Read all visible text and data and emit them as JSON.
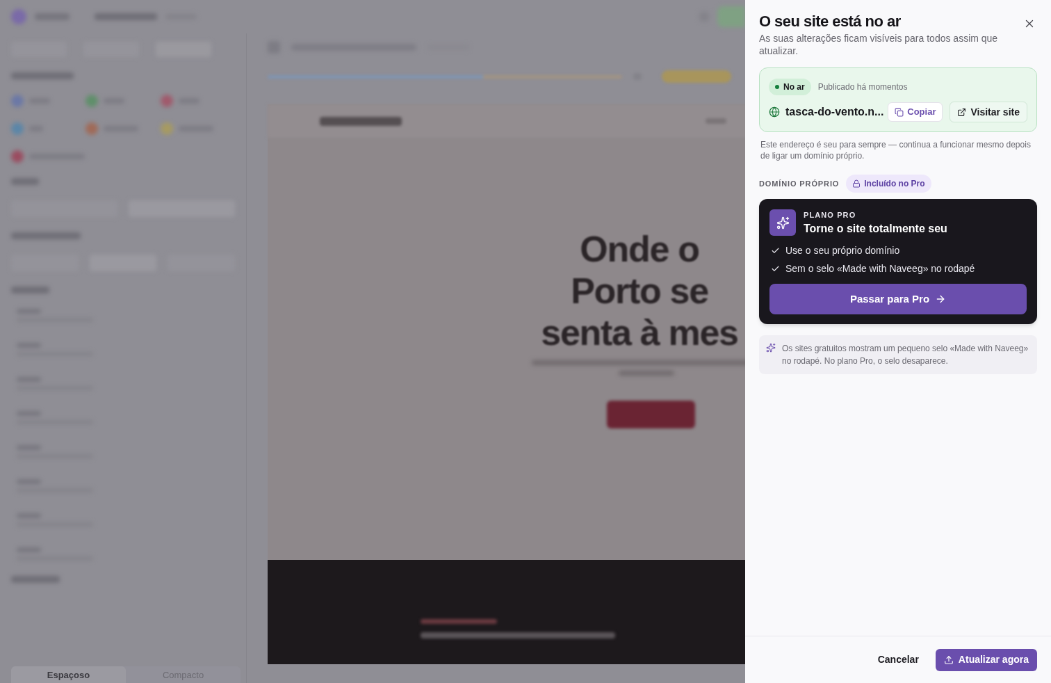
{
  "backdrop": {
    "hero_heading": "Onde o Porto se senta à mes",
    "density_options": [
      {
        "label": "Espaçoso",
        "selected": true
      },
      {
        "label": "Compacto",
        "selected": false
      }
    ]
  },
  "panel": {
    "title": "O seu site está no ar",
    "subtitle": "As suas alterações ficam visíveis para todos assim que atualizar.",
    "status_card": {
      "status": "No ar",
      "published": "Publicado há momentos",
      "url": "tasca-do-vento.n...",
      "copy_button": "Copiar",
      "visit_button": "Visitar site"
    },
    "address_note": "Este endereço é seu para sempre — continua a funcionar mesmo depois de ligar um domínio próprio.",
    "custom_domain": {
      "label": "DOMÍNIO PRÓPRIO",
      "badge": "Incluído no Pro"
    },
    "pro_card": {
      "eyebrow": "PLANO PRO",
      "title": "Torne o site totalmente seu",
      "features": [
        "Use o seu próprio domínio",
        "Sem o selo «Made with Naveeg» no rodapé"
      ],
      "cta": "Passar para Pro"
    },
    "info_note": "Os sites gratuitos mostram um pequeno selo «Made with Naveeg» no rodapé. No plano Pro, o selo desaparece.",
    "footer": {
      "cancel": "Cancelar",
      "confirm": "Atualizar agora"
    }
  }
}
